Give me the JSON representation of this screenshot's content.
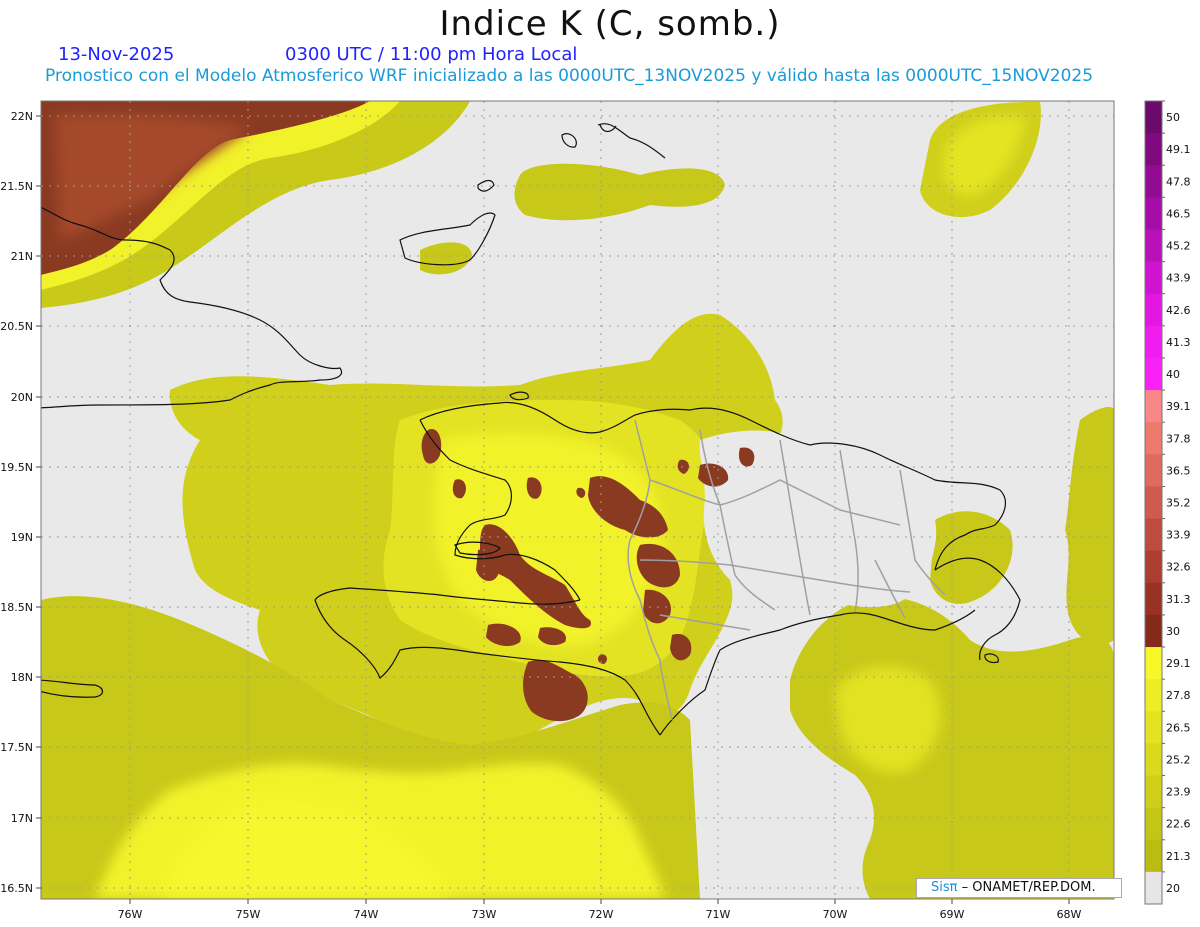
{
  "header": {
    "title": "Indice K (C, somb.)",
    "date": "13-Nov-2025",
    "time": "0300 UTC / 11:00 pm Hora Local",
    "subtitle": "Pronostico con el Modelo Atmosferico WRF inicializado a las 0000UTC_13NOV2025 y válido hasta las 0000UTC_15NOV2025"
  },
  "map": {
    "lat_labels": [
      "22N",
      "21.5N",
      "21N",
      "20.5N",
      "20N",
      "19.5N",
      "19N",
      "18.5N",
      "18N",
      "17.5N",
      "17N",
      "16.5N"
    ],
    "lon_labels": [
      "76W",
      "75W",
      "74W",
      "73W",
      "72W",
      "71W",
      "70W",
      "69W",
      "68W"
    ],
    "colors": {
      "background": "#e9e9e9",
      "olive": "#c2c218",
      "olive_mid": "#d2d21e",
      "yellow_mid": "#e2e224",
      "yellow": "#f2f22a",
      "brown": "#8b3a22",
      "brown_light": "#a4492c",
      "coast": "#111111",
      "border": "#a0a0a0"
    }
  },
  "colorbar": {
    "labels": [
      "50",
      "49.1",
      "47.8",
      "46.5",
      "45.2",
      "43.9",
      "42.6",
      "41.3",
      "40",
      "39.1",
      "37.8",
      "36.5",
      "35.2",
      "33.9",
      "32.6",
      "31.3",
      "30",
      "29.1",
      "27.8",
      "26.5",
      "25.2",
      "23.9",
      "22.6",
      "21.3",
      "20"
    ],
    "colors": [
      "#6a0a6a",
      "#7e0a7e",
      "#920c92",
      "#a60ca6",
      "#ba10ba",
      "#ce14ce",
      "#e218e2",
      "#f01cf0",
      "#f822f8",
      "#f88888",
      "#ee7a6e",
      "#e06a5c",
      "#d05a4c",
      "#be4c3e",
      "#ab3e31",
      "#973224",
      "#842a1a",
      "#f7f72a",
      "#eded26",
      "#e3e322",
      "#d9d91e",
      "#cfcf1a",
      "#c5c516",
      "#bbbb12",
      "#e6e6e6"
    ]
  },
  "credit": {
    "brand": "Sisπ",
    "rest": " – ONAMET/REP.DOM."
  }
}
